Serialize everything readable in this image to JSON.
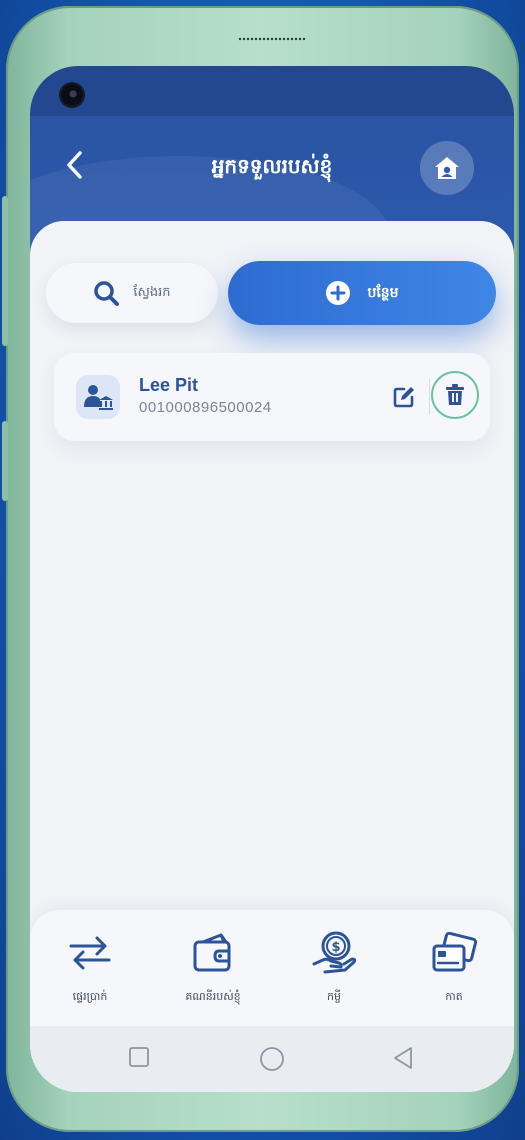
{
  "header": {
    "title": "អ្នកទទួលរបស់ខ្ញុំ",
    "back_icon": "chevron-left-icon",
    "home_icon": "home-icon"
  },
  "actions": {
    "search_label": "ស្វែងរក",
    "add_label": "បន្ថែម"
  },
  "recipients": [
    {
      "name": "Lee Pit",
      "account": "001000896500024",
      "avatar_icon": "user-bank-icon",
      "edit_icon": "edit-icon",
      "delete_icon": "trash-icon"
    }
  ],
  "bottom_nav": [
    {
      "label": "ផ្ទេរប្រាក់",
      "icon": "transfer-icon"
    },
    {
      "label": "គណនីរបស់ខ្ញុំ",
      "icon": "wallet-icon"
    },
    {
      "label": "កម្ចី",
      "icon": "loan-icon"
    },
    {
      "label": "កាត",
      "icon": "card-icon"
    }
  ],
  "colors": {
    "primary": "#2e5cb0",
    "accent": "#3f86e6",
    "delete_ring": "#6cc29f",
    "phone_frame": "#b7dfca"
  }
}
